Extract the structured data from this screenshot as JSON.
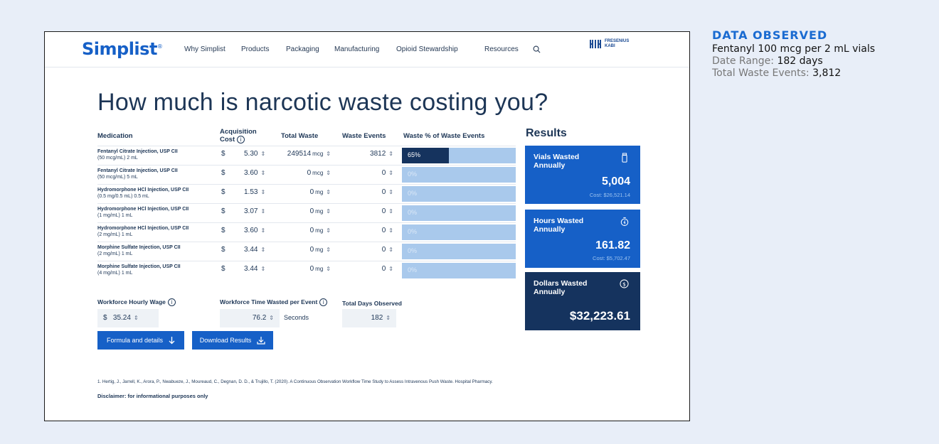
{
  "header": {
    "logo": "Simplist",
    "logo_mark": "®",
    "nav": [
      "Why Simplist",
      "Products",
      "Packaging",
      "Manufacturing",
      "Opioid Stewardship",
      "Resources"
    ],
    "brand_line1": "FRESENIUS",
    "brand_line2": "KABI"
  },
  "title": "How much is narcotic waste costing you?",
  "table": {
    "headers": {
      "medication": "Medication",
      "acq_line1": "Acquisition",
      "acq_line2": "Cost",
      "total_waste": "Total Waste",
      "waste_events": "Waste Events",
      "waste_pct": "Waste % of Waste Events"
    },
    "currency": "$",
    "rows": [
      {
        "name": "Fentanyl Citrate Injection, USP CII",
        "detail": "(50 mcg/mL) 2 mL",
        "cost": "5.30",
        "waste": "249514",
        "unit": "mcg",
        "events": "3812",
        "pct": "65%",
        "fill": 0.41
      },
      {
        "name": "Fentanyl Citrate Injection, USP CII",
        "detail": "(50 mcg/mL) 5 mL",
        "cost": "3.60",
        "waste": "0",
        "unit": "mcg",
        "events": "0",
        "pct": "0%",
        "fill": 0
      },
      {
        "name": "Hydromorphone HCl Injection, USP CII",
        "detail": "(0.5 mg/0.5 mL) 0.5 mL",
        "cost": "1.53",
        "waste": "0",
        "unit": "mg",
        "events": "0",
        "pct": "0%",
        "fill": 0
      },
      {
        "name": "Hydromorphone HCl Injection, USP CII",
        "detail": "(1 mg/mL) 1 mL",
        "cost": "3.07",
        "waste": "0",
        "unit": "mg",
        "events": "0",
        "pct": "0%",
        "fill": 0
      },
      {
        "name": "Hydromorphone HCl Injection, USP CII",
        "detail": "(2 mg/mL) 1 mL",
        "cost": "3.60",
        "waste": "0",
        "unit": "mg",
        "events": "0",
        "pct": "0%",
        "fill": 0
      },
      {
        "name": "Morphine Sulfate Injection, USP CII",
        "detail": "(2 mg/mL) 1 mL",
        "cost": "3.44",
        "waste": "0",
        "unit": "mg",
        "events": "0",
        "pct": "0%",
        "fill": 0
      },
      {
        "name": "Morphine Sulfate Injection, USP CII",
        "detail": "(4 mg/mL) 1 mL",
        "cost": "3.44",
        "waste": "0",
        "unit": "mg",
        "events": "0",
        "pct": "0%",
        "fill": 0
      }
    ]
  },
  "inputs": {
    "wage_label": "Workforce Hourly Wage",
    "wage": "35.24",
    "time_label": "Workforce Time Wasted per Event",
    "time": "76.2",
    "time_unit": "Seconds",
    "days_label": "Total Days Observed",
    "days": "182"
  },
  "results": {
    "title": "Results",
    "vials_label": "Vials Wasted Annually",
    "vials_value": "5,004",
    "vials_cost": "Cost: $26,521.14",
    "hours_label": "Hours Wasted Annually",
    "hours_value": "161.82",
    "hours_cost": "Cost: $5,702.47",
    "dollars_label": "Dollars Wasted Annually",
    "dollars_value": "$32,223.61"
  },
  "buttons": {
    "formula": "Formula and details",
    "download": "Download Results"
  },
  "reference": "1. Hertig, J., Jarrell, K., Arora, P., Nwabueze, J., Moureaud, C., Degnan, D. D., & Trujillo, T. (2020). A Continuous Observation Workflow Time Study to Assess Intravenous Push Waste. Hospital Pharmacy.",
  "disclaimer": "Disclaimer: for informational purposes only",
  "side": {
    "title": "DATA OBSERVED",
    "subtitle": "Fentanyl 100 mcg per 2 mL vials",
    "range_label": "Date Range:",
    "range_value": "182 days",
    "events_label": "Total Waste Events:",
    "events_value": "3,812"
  },
  "colors": {
    "brand_blue": "#1660c7",
    "navy": "#15335e",
    "bar_light": "#a9c9ec",
    "accent_title": "#1a6bd1"
  }
}
